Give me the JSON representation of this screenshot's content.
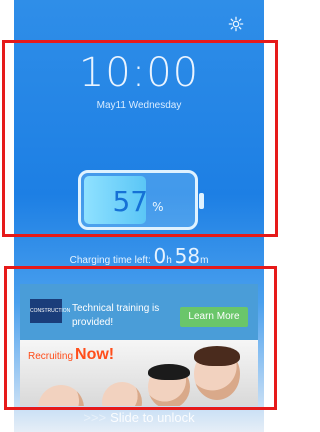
{
  "lockscreen": {
    "time": "10:00",
    "date": "May11  Wednesday",
    "battery_percent_value": "57",
    "battery_percent_symbol": "%",
    "battery_level": 0.57,
    "charging_label": "Charging time left:",
    "charging_hours": "0",
    "charging_hours_unit": "h",
    "charging_minutes": "58",
    "charging_minutes_unit": "m",
    "slide_arrows": ">>>",
    "slide_text": "Slide to unlock"
  },
  "ad": {
    "logo_text": "CONSTRUCTION",
    "text": "Technical training is provided!",
    "button_label": "Learn More",
    "banner_small": "Recruiting",
    "banner_big": "Now!"
  },
  "colors": {
    "highlight": "#e61a1a",
    "button": "#6ac66a"
  }
}
